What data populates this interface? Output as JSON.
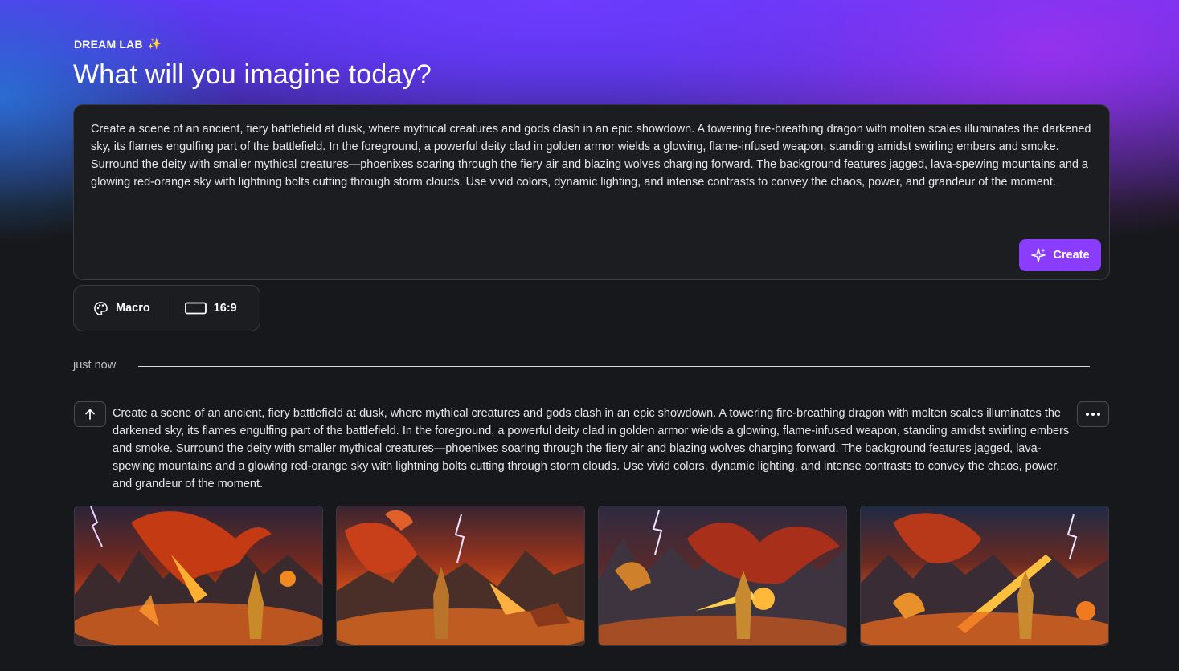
{
  "header": {
    "eyebrow": "DREAM LAB",
    "eyebrow_icon": "sparkles-icon",
    "title": "What will you imagine today?"
  },
  "prompt": {
    "text": "Create a scene of an ancient, fiery battlefield at dusk, where mythical creatures and gods clash in an epic showdown. A towering fire-breathing dragon with molten scales illuminates the darkened sky, its flames engulfing part of the battlefield. In the foreground, a powerful deity clad in golden armor wields a glowing, flame-infused weapon, standing amidst swirling embers and smoke. Surround the deity with smaller mythical creatures—phoenixes soaring through the fiery air and blazing wolves charging forward. The background features jagged, lava-spewing mountains and a glowing red-orange sky with lightning bolts cutting through storm clouds. Use vivid colors, dynamic lighting, and intense contrasts to convey the chaos, power, and grandeur of the moment.",
    "create_label": "Create"
  },
  "options": {
    "style_label": "Macro",
    "style_icon": "palette-icon",
    "ratio_label": "16:9",
    "ratio_icon": "aspect-ratio-icon"
  },
  "history": {
    "time_label": "just now",
    "prompt_text": "Create a scene of an ancient, fiery battlefield at dusk, where mythical creatures and gods clash in an epic showdown. A towering fire-breathing dragon with molten scales illuminates the darkened sky, its flames engulfing part of the battlefield. In the foreground, a powerful deity clad in golden armor wields a glowing, flame-infused weapon, standing amidst swirling embers and smoke. Surround the deity with smaller mythical creatures—phoenixes soaring through the fiery air and blazing wolves charging forward. The background features jagged, lava-spewing mountains and a glowing red-orange sky with lightning bolts cutting through storm clouds. Use vivid colors, dynamic lighting, and intense contrasts to convey the chaos, power, and grandeur of the moment.",
    "results_count": 4
  },
  "colors": {
    "accent": "#8b3dff",
    "background": "#17181b",
    "panel": "#1c1d21",
    "border": "#3a3b42"
  }
}
